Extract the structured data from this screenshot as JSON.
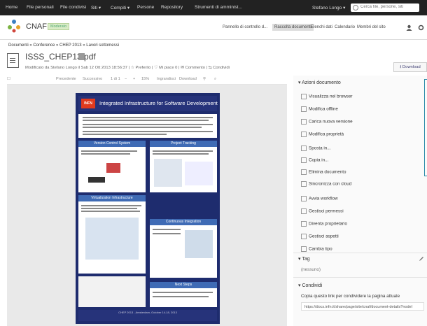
{
  "topbar": {
    "items": [
      "Home",
      "File personali",
      "File condivisi",
      "Siti ▾",
      "Compiti ▾",
      "Persone",
      "Repository",
      "Strumenti di amminist..."
    ],
    "user": "Stefano Longo ▾",
    "search_placeholder": "Cerca file, persone, siti"
  },
  "header": {
    "site_name": "CNAF",
    "badge": "Moderato",
    "nav": [
      "Pannello di controllo d...",
      "Raccolta documenti",
      "Elenchi dati",
      "Calendario",
      "Membri del sito"
    ],
    "active_nav": "Raccolta documenti"
  },
  "breadcrumb": "Documenti  »  Conference  »  CHEP 2013  »  Lavori sottomessi",
  "document": {
    "title": "ISSS_CHEP13.pdf",
    "meta": "Modificato da Stefano Longo il Sab 12 Ott 2013 18:56:37   |   ☆ Preferito   |   ♡ Mi piace  0   |   ✉ Commento   |   ⇆ Condividi",
    "download_label": "⭳ Download"
  },
  "viewer": {
    "prev": "Precedente",
    "next": "Successivo",
    "page": "1 di 1",
    "zoom": "15%",
    "enlarge": "Ingrandisci",
    "download": "Download"
  },
  "poster": {
    "logo": "INFN",
    "title": "Integrated Infrastructure for Software Development",
    "boxes": [
      "Version Control System",
      "Project Tracking",
      "Virtualization Infrastructure",
      "Continuous Integration",
      "Next Steps"
    ],
    "footer": "CHEP 2013 - Amsterdam, October 14-18, 2013"
  },
  "side": {
    "actions_title": "▾ Azioni documento",
    "actions": [
      "Visualizza nel browser",
      "Modifica offline",
      "Carica nuova versione",
      "Modifica proprietà",
      "Sposta in...",
      "Copia in...",
      "Elimina documento",
      "Sincronizza con cloud",
      "Avvia workflow",
      "Gestisci permessi",
      "Diventa proprietario",
      "Gestisci aspetti",
      "Cambia tipo"
    ],
    "tag_title": "▾ Tag",
    "tag_value": "(nessuno)",
    "share_title": "▾ Condividi",
    "share_text": "Copia questo link per condividere la pagina attuale",
    "share_link": "https://docs.infn.it/share/page/site/cnaf/document-details?nodeI"
  }
}
